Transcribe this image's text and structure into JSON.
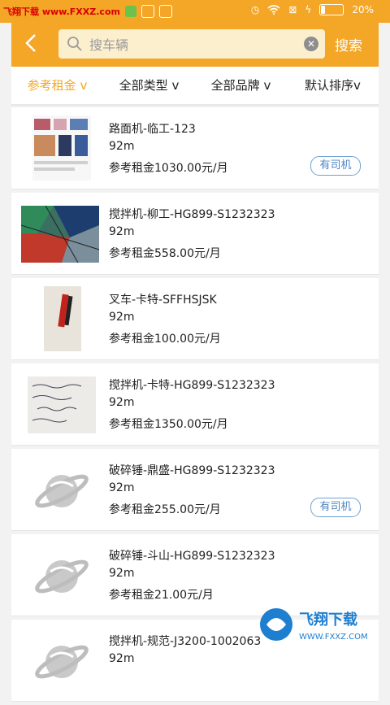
{
  "status_bar": {
    "watermark": "飞翔下载 www.FXXZ.com",
    "battery_percent": 20,
    "battery_text": "20%"
  },
  "header": {
    "back_icon": "chevron-left-icon",
    "search_placeholder": "搜车辆",
    "search_button": "搜索"
  },
  "filters": [
    {
      "label": "参考租金 v",
      "active": true
    },
    {
      "label": "全部类型 v",
      "active": false
    },
    {
      "label": "全部品牌 v",
      "active": false
    },
    {
      "label": "默认排序v",
      "active": false
    }
  ],
  "items": [
    {
      "name": "路面机-临工-123",
      "distance": "92m",
      "price": "参考租金1030.00元/月",
      "badge": "有司机",
      "thumb": "catalog-photo"
    },
    {
      "name": "搅拌机-柳工-HG899-S1232323",
      "distance": "92m",
      "price": "参考租金558.00元/月",
      "badge": "",
      "thumb": "stained-glass-photo"
    },
    {
      "name": "叉车-卡特-SFFHSJSK",
      "distance": "92m",
      "price": "参考租金100.00元/月",
      "badge": "",
      "thumb": "pen-photo"
    },
    {
      "name": "搅拌机-卡特-HG899-S1232323",
      "distance": "92m",
      "price": "参考租金1350.00元/月",
      "badge": "",
      "thumb": "notes-photo"
    },
    {
      "name": "破碎锤-鼎盛-HG899-S1232323",
      "distance": "92m",
      "price": "参考租金255.00元/月",
      "badge": "有司机",
      "thumb": "planet-logo-placeholder"
    },
    {
      "name": "破碎锤-斗山-HG899-S1232323",
      "distance": "92m",
      "price": "参考租金21.00元/月",
      "badge": "",
      "thumb": "planet-logo-placeholder"
    },
    {
      "name": "搅拌机-规范-J3200-1002063",
      "distance": "92m",
      "price": "",
      "badge": "",
      "thumb": "planet-logo-placeholder"
    }
  ],
  "corner_watermark": {
    "text": "飞翔下载",
    "url": "WWW.FXXZ.COM"
  },
  "colors": {
    "brand": "#f4a626",
    "badge": "#4d83c2"
  }
}
